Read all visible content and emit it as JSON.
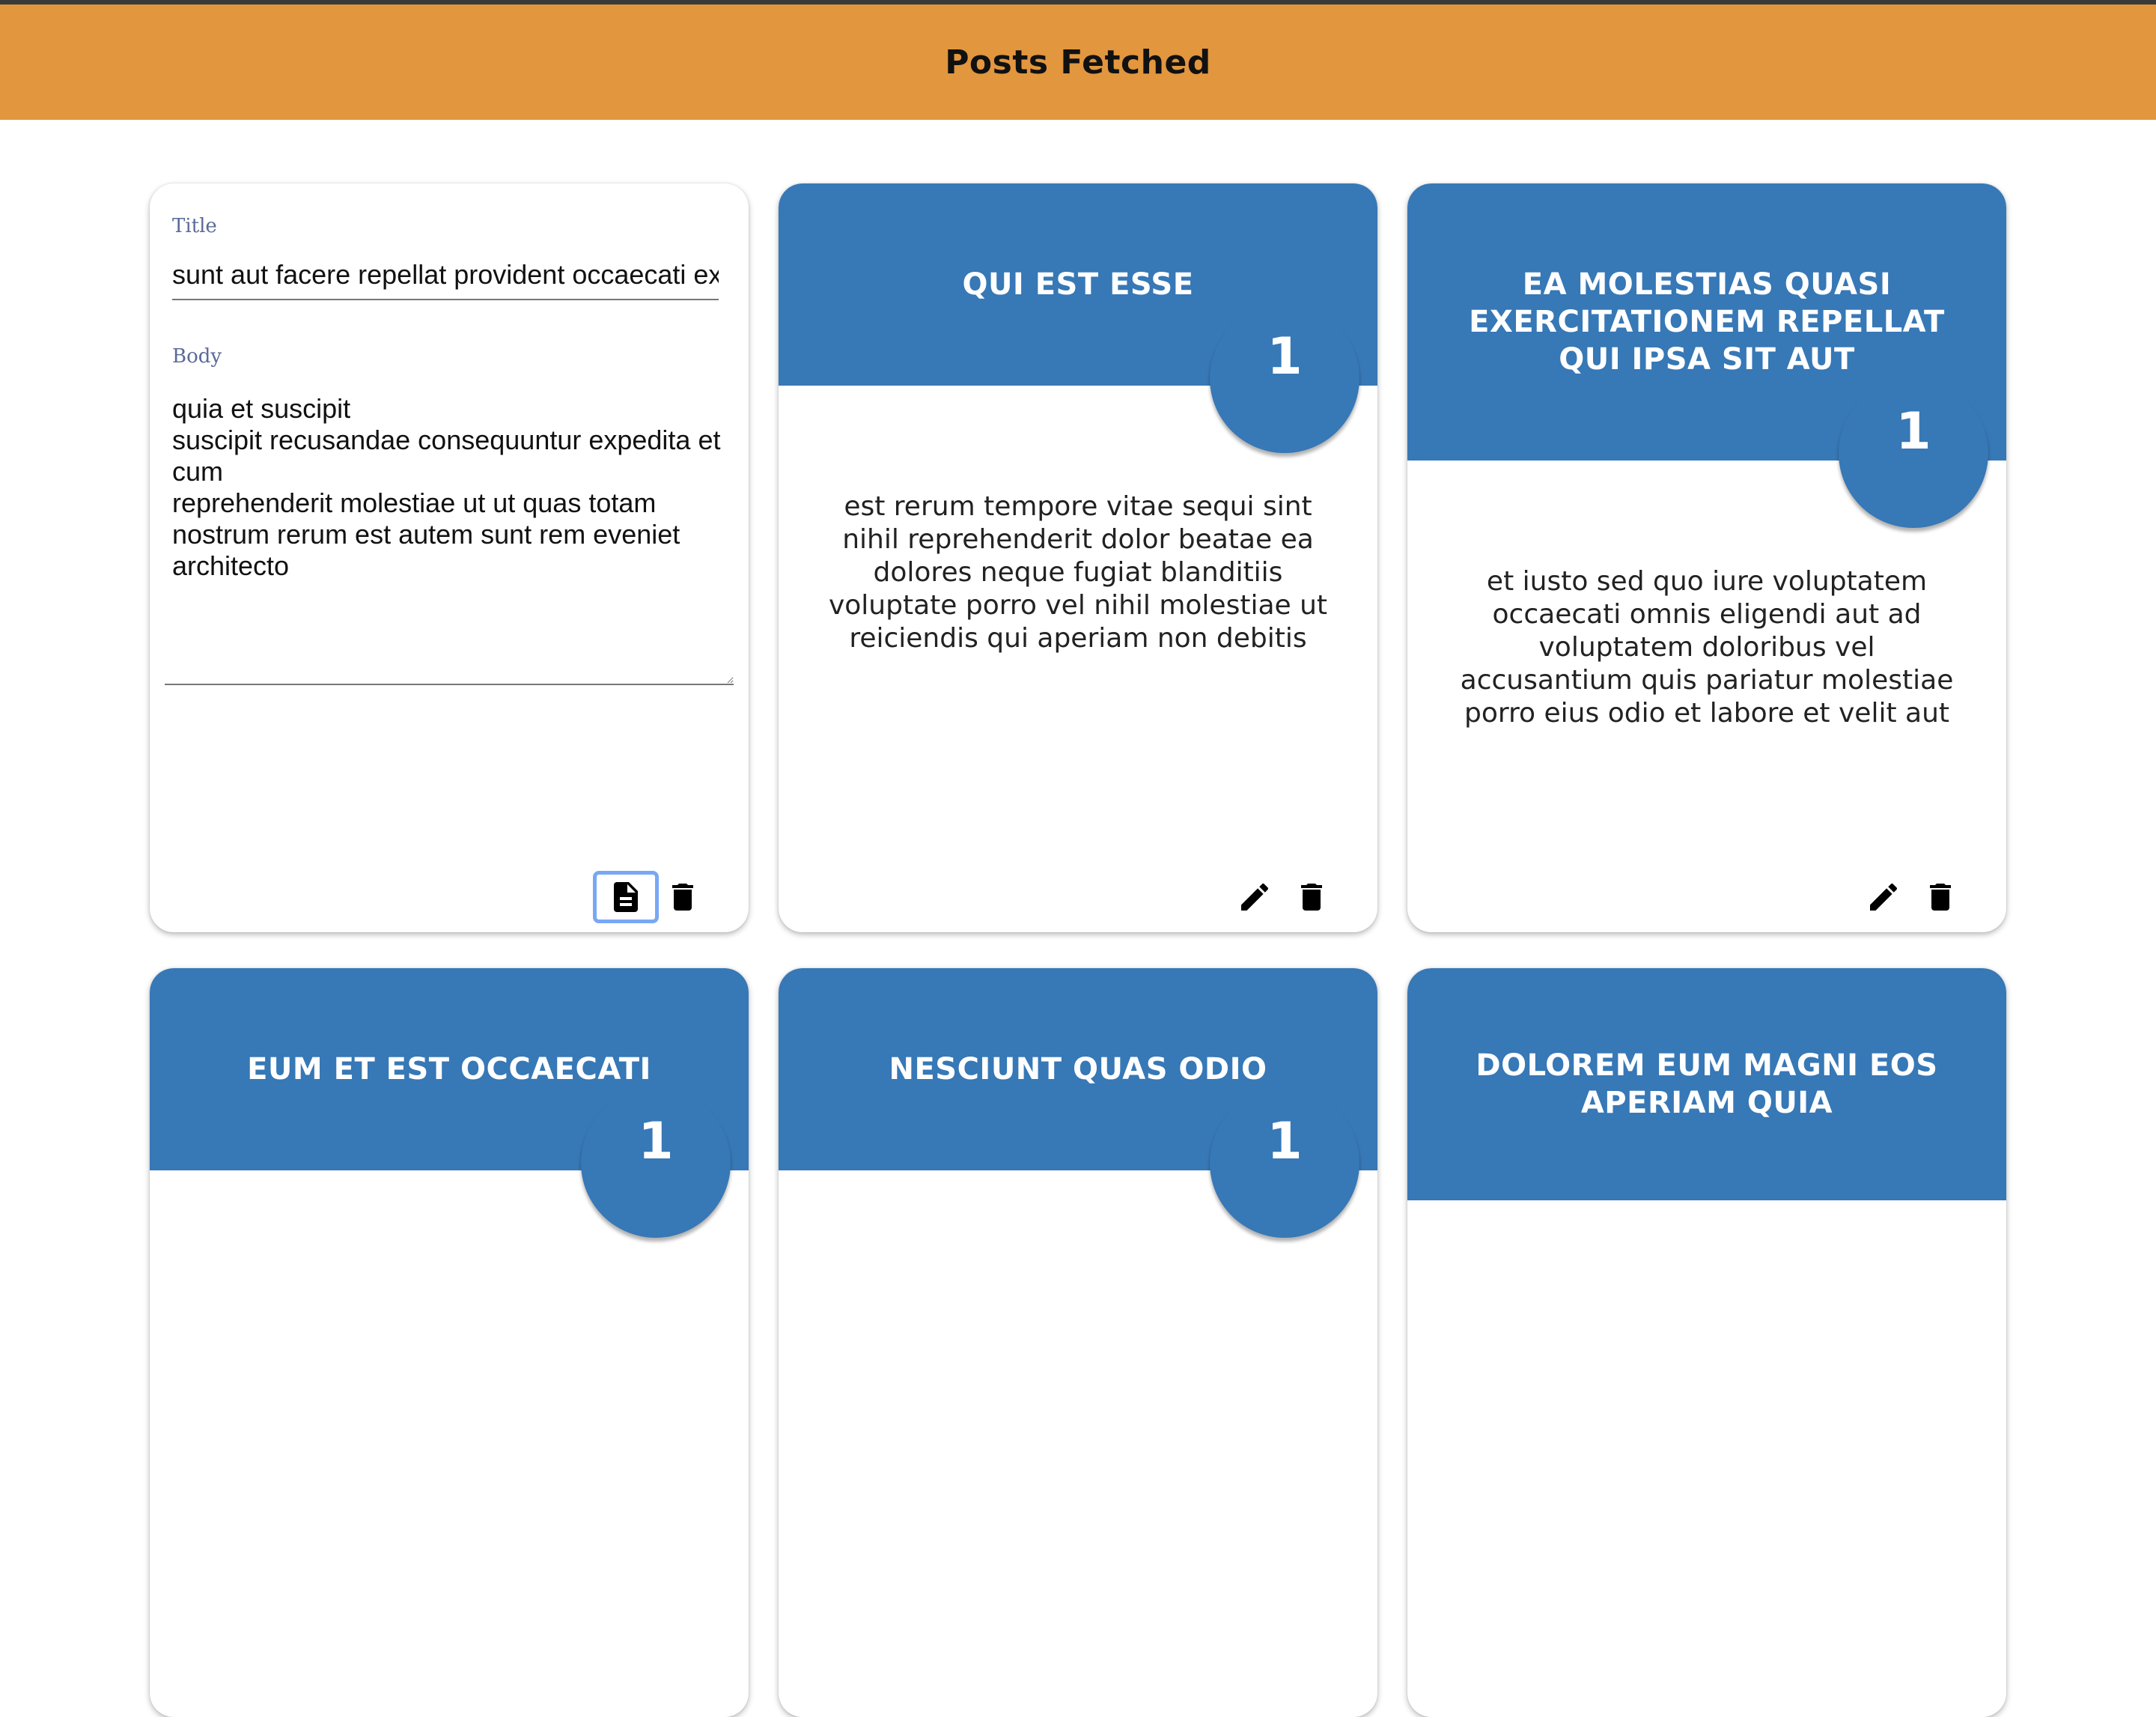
{
  "header": {
    "title": "Posts Fetched"
  },
  "edit_card": {
    "title_label": "Title",
    "title_value": "sunt aut facere repellat provident occaecati excepturi optio reprehenderit",
    "body_label": "Body",
    "body_value": "quia et suscipit\nsuscipit recusandae consequuntur expedita et cum\nreprehenderit molestiae ut ut quas totam\nnostrum rerum est autem sunt rem eveniet architecto"
  },
  "cards": [
    {
      "title": "qui est esse",
      "user_id": "1",
      "body": "est rerum tempore vitae sequi sint nihil reprehenderit dolor beatae ea dolores neque fugiat blanditiis voluptate porro vel nihil molestiae ut reiciendis qui aperiam non debitis possimus qui neque nisi nulla"
    },
    {
      "title": "ea molestias quasi exercitationem repellat qui ipsa sit aut",
      "user_id": "1",
      "body": "et iusto sed quo iure voluptatem occaecati omnis eligendi aut ad voluptatem doloribus vel accusantium quis pariatur molestiae porro eius odio et labore et velit aut"
    },
    {
      "title": "eum et est occaecati",
      "user_id": "1"
    },
    {
      "title": "nesciunt quas odio",
      "user_id": "1"
    },
    {
      "title": "dolorem eum magni eos aperiam quia"
    }
  ],
  "colors": {
    "header": "#e2963e",
    "card_accent": "#3778b6"
  },
  "icons": {
    "save": "document-icon",
    "edit": "pencil-icon",
    "delete": "trash-icon"
  }
}
